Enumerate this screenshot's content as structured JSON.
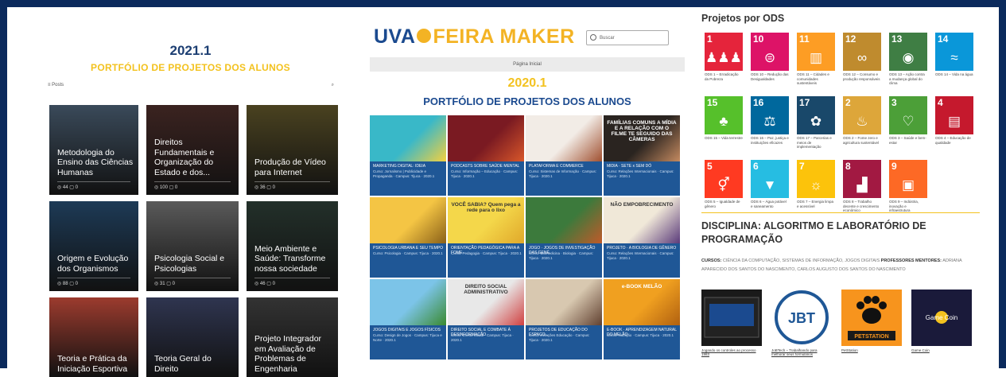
{
  "panel1": {
    "year": "2021.1",
    "subtitle": "PORTFÓLIO DE PROJETOS DOS ALUNOS",
    "bar_left": "≡ Posts",
    "bar_right": "⌕",
    "cards": [
      {
        "title": "Metodologia do Ensino das Ciências Humanas",
        "meta": "◎ 44  ▢ 0",
        "bg": "#3a4a5a"
      },
      {
        "title": "Direitos Fundamentais e Organização do Estado e dos...",
        "meta": "◎ 100  ▢ 0",
        "bg": "#3b2320"
      },
      {
        "title": "Produção de Vídeo para Internet",
        "meta": "◎ 36  ▢ 0",
        "bg": "#4a4220"
      },
      {
        "title": "Origem e Evolução dos Organismos",
        "meta": "◎ 88  ▢ 0",
        "bg": "#1d3a56"
      },
      {
        "title": "Psicologia Social e Psicologias",
        "meta": "◎ 31  ▢ 0",
        "bg": "#5a5a5a"
      },
      {
        "title": "Meio Ambiente e Saúde: Transforme nossa sociedade",
        "meta": "◎ 46  ▢ 0",
        "bg": "#23302a"
      },
      {
        "title": "Teoria e Prática da Iniciação Esportiva",
        "meta": "",
        "bg": "#9c3b2e"
      },
      {
        "title": "Teoria Geral do Direito",
        "meta": "",
        "bg": "#2f3550"
      },
      {
        "title": "Projeto Integrador em Avaliação de Problemas de Engenharia",
        "meta": "",
        "bg": "#333"
      }
    ]
  },
  "panel2": {
    "logo_uva": "UVA",
    "logo_feira": "FEIRA MAKER",
    "search_placeholder": "Buscar",
    "home": "Página Inicial",
    "year": "2020.1",
    "subtitle": "PORTFÓLIO DE PROJETOS DOS ALUNOS",
    "cards": [
      {
        "t": "MARKETING DIGITAL: IDEIA",
        "m": "Curso: Jornalismo | Publicidade e Propaganda · Campus: Tijuca · 2020.1",
        "c1": "#39b8c8",
        "c2": "#f4d03f",
        "txt": ""
      },
      {
        "t": "PODCASTS SOBRE SAÚDE MENTAL",
        "m": "Curso: Informação – Educação · Campus: Tijuca · 2020.1",
        "c1": "#7a1a22",
        "c2": "#d8572a",
        "txt": ""
      },
      {
        "t": "PLATAFORMA E COMMERCE",
        "m": "Curso: Sistemas de Informação · Campus: Tijuca · 2020.1",
        "c1": "#f2ece6",
        "c2": "#a05030",
        "txt": ""
      },
      {
        "t": "MIDIA · SETE x SEM DÓ",
        "m": "Curso: Relações Internacionais · Campus: Tijuca · 2020.1",
        "c1": "#2a2420",
        "c2": "#c48a60",
        "txt": "FAMÍLIAS COMUNS A MÍDIA E A RELAÇÃO COM O FILME TE SEGUIDO DAS CÂMERAS"
      },
      {
        "t": "PSICOLOGIA URBANA E SEU TEMPO",
        "m": "Curso: Psicologia · Campus: Tijuca · 2020.1",
        "c1": "#f4c544",
        "c2": "#8a6018",
        "txt": ""
      },
      {
        "t": "ORIENTAÇÃO PEDAGÓGICA PARA A FOME",
        "m": "Curso: Pedagogia · Campus: Tijuca · 2020.1",
        "c1": "#f4d74a",
        "c2": "#e0a82a",
        "txt": "VOCÊ SABIA? Quem pega a rede para o lixo"
      },
      {
        "t": "JOGO · JOGOS DE INVESTIGAÇÃO DAS GENÉ...",
        "m": "Curso: Biomedicina · Biologia · Campus: Tijuca · 2020.1",
        "c1": "#3c7a3c",
        "c2": "#c05a2a",
        "txt": ""
      },
      {
        "t": "PROJETO · A BIOLOGIA DE GÊNERO",
        "m": "Curso: Relações Internacionais · Campus: Tijuca · 2020.1",
        "c1": "#f0e8d8",
        "c2": "#5a3a7a",
        "txt": "NÃO EMPOBRECIMENTO"
      },
      {
        "t": "JOGOS DIGITAIS E JOGOS FÍSICOS",
        "m": "Curso: Design de Jogos · Campus: Tijuca e Norte · 2020.1",
        "c1": "#7cc4e8",
        "c2": "#3a8a30",
        "txt": ""
      },
      {
        "t": "DIREITO SOCIAL E COMBATE À DESINFORMAÇÃO",
        "m": "Curso: Direito Social · Campus: Tijuca · 2020.1",
        "c1": "#e8e8e8",
        "c2": "#d04040",
        "txt": "DIREITO SOCIAL ADMINISTRATIVO"
      },
      {
        "t": "PROJETOS DE EDUCAÇÃO DO ESPAÇO...",
        "m": "Curso: Relações Educação · Campus: Tijuca · 2020.1",
        "c1": "#d8c8b0",
        "c2": "#604030",
        "txt": ""
      },
      {
        "t": "E-BOOK · APRENDIZAGEM NATURAL DO MELÃO",
        "m": "Curso: Nutrição · Campus: Tijuca · 2020.1",
        "c1": "#f0a020",
        "c2": "#b06010",
        "txt": "e-BOOK MELÃO"
      }
    ]
  },
  "panel3": {
    "ods_title": "Projetos por ODS",
    "ods": [
      {
        "n": "1",
        "c": "#e5243b",
        "s": "♟♟♟",
        "cap": "ODS 1 – Erradicação da Pobreza"
      },
      {
        "n": "10",
        "c": "#dd1367",
        "s": "⊜",
        "cap": "ODS 10 – Redução das Desigualdades"
      },
      {
        "n": "11",
        "c": "#fd9d24",
        "s": "▥",
        "cap": "ODS 11 – Cidades e comunidades sustentáveis"
      },
      {
        "n": "12",
        "c": "#bf8b2e",
        "s": "∞",
        "cap": "ODS 12 – Consumo e produção responsáveis"
      },
      {
        "n": "13",
        "c": "#3f7e44",
        "s": "◉",
        "cap": "ODS 13 – Ação contra a mudança global do clima"
      },
      {
        "n": "14",
        "c": "#0a97d9",
        "s": "≈",
        "cap": "ODS 14 – Vida na água"
      },
      {
        "n": "15",
        "c": "#56c02b",
        "s": "♣",
        "cap": "ODS 15 – Vida terrestre"
      },
      {
        "n": "16",
        "c": "#00689d",
        "s": "⚖",
        "cap": "ODS 16 – Paz, justiça e instituições eficazes"
      },
      {
        "n": "17",
        "c": "#19486a",
        "s": "✿",
        "cap": "ODS 17 – Parcerias e meios de implementação"
      },
      {
        "n": "2",
        "c": "#dda63a",
        "s": "♨",
        "cap": "ODS 2 – Fome zero e agricultura sustentável"
      },
      {
        "n": "3",
        "c": "#4c9f38",
        "s": "♡",
        "cap": "ODS 3 – Saúde e bem-estar"
      },
      {
        "n": "4",
        "c": "#c5192d",
        "s": "▤",
        "cap": "ODS 4 – Educação de qualidade"
      },
      {
        "n": "5",
        "c": "#ff3a21",
        "s": "⚥",
        "cap": "ODS 5 – Igualdade de gênero"
      },
      {
        "n": "6",
        "c": "#26bde2",
        "s": "▼",
        "cap": "ODS 6 – Água potável e saneamento"
      },
      {
        "n": "7",
        "c": "#fcc30b",
        "s": "☼",
        "cap": "ODS 7 – Energia limpa e acessível"
      },
      {
        "n": "8",
        "c": "#a21942",
        "s": "▟",
        "cap": "ODS 8 – Trabalho decente e crescimento econômico"
      },
      {
        "n": "9",
        "c": "#fd6925",
        "s": "▣",
        "cap": "ODS 9 – Indústria, inovação e infraestrutura"
      }
    ],
    "discipline_title": "DISCIPLINA: ALGORITMO E LABORATÓRIO DE PROGRAMAÇÃO",
    "courses_label": "CURSOS:",
    "courses_text": "CIÊNCIA DA COMPUTAÇÃO, SISTEMAS DE INFORMAÇÃO, JOGOS DIGITAIS",
    "professors_label": "PROFESSORES MENTORES:",
    "professors_text": "ADRIANA APARECIDO DOS SANTOS DO NASCIMENTO, CARLOS AUGUSTO DOS SANTOS DO NASCIMENTO",
    "projects": [
      {
        "cap": "Jogando os controles ao processo 1983",
        "bg": "#1a1a1a"
      },
      {
        "cap": "JoBTech – Trabalhando para melhorar seus formulários",
        "bg": "#ffffff",
        "logo": "JBT"
      },
      {
        "cap": "PetStation",
        "bg": "#f7941d",
        "logo": "PETSTATION"
      },
      {
        "cap": "Game Coin",
        "bg": "#1a1a3a",
        "logo": "Game Coin"
      }
    ]
  }
}
